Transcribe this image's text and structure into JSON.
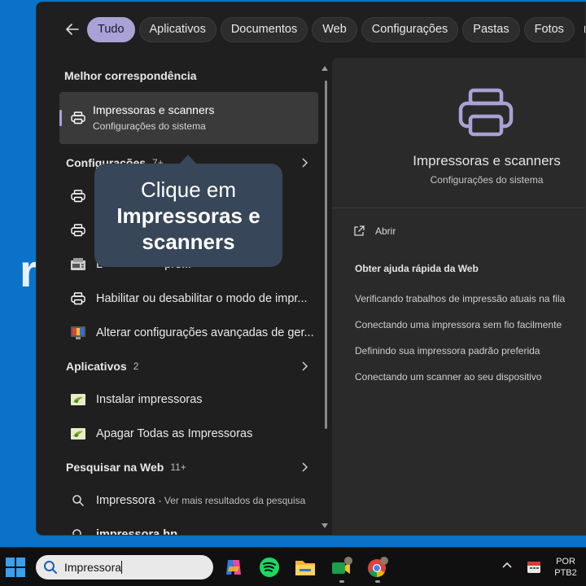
{
  "desktop": {
    "glyph": "r"
  },
  "filters": {
    "back_label": "Voltar",
    "chips": [
      "Tudo",
      "Aplicativos",
      "Documentos",
      "Web",
      "Configurações",
      "Pastas",
      "Fotos"
    ],
    "active": "Tudo"
  },
  "best_match": {
    "header": "Melhor correspondência",
    "title": "Impressoras e scanners",
    "subtitle": "Configurações do sistema"
  },
  "settings_section": {
    "title": "Configurações",
    "count": "7+",
    "items": [
      "A",
      "I",
      "L                   pre...",
      "Habilitar ou desabilitar o modo de impr...",
      "Alterar configurações avançadas de ger..."
    ]
  },
  "apps_section": {
    "title": "Aplicativos",
    "count": "2",
    "items": [
      "Instalar impressoras",
      "Apagar Todas as Impressoras"
    ]
  },
  "web_section": {
    "title": "Pesquisar na Web",
    "count": "11+",
    "items": [
      {
        "text": "Impressora",
        "sub": "- Ver mais resultados da pesquisa"
      },
      {
        "text": "impressora hp",
        "sub": ""
      }
    ]
  },
  "detail": {
    "title": "Impressoras e scanners",
    "subtitle": "Configurações do sistema",
    "open_label": "Abrir",
    "help_header": "Obter ajuda rápida da Web",
    "help_links": [
      "Verificando trabalhos de impressão atuais na fila",
      "Conectando uma impressora sem fio facilmente",
      "Definindo sua impressora padrão preferida",
      "Conectando um scanner ao seu dispositivo"
    ]
  },
  "callout": {
    "line1": "Clique em",
    "line2": "Impressoras e",
    "line3": "scanners"
  },
  "taskbar": {
    "search_value": "Impressora",
    "lang_line1": "POR",
    "lang_line2": "PTB2"
  },
  "colors": {
    "accent": "#a8a2d6",
    "desktop": "#0a72c8",
    "callout": "#374658"
  }
}
